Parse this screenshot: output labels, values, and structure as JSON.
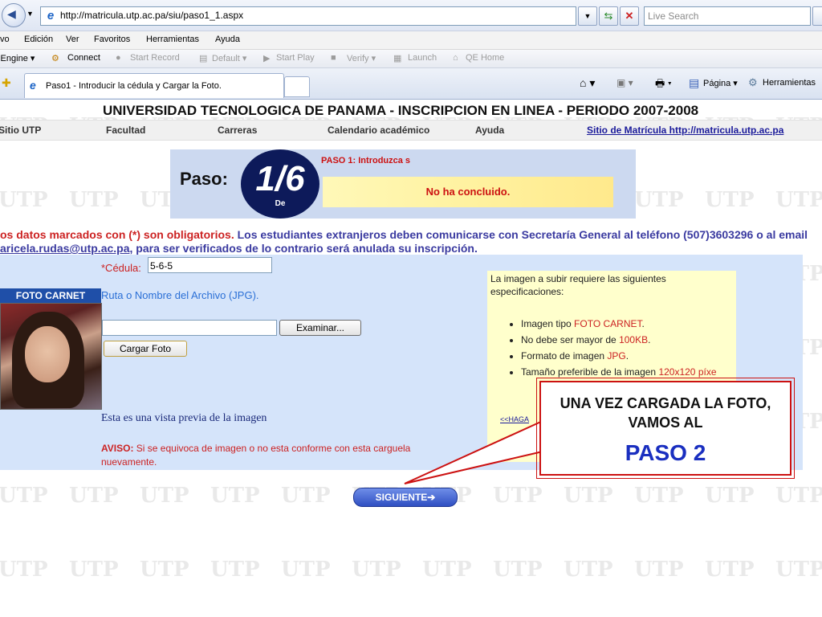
{
  "browser": {
    "url": "http://matricula.utp.ac.pa/siu/paso1_1.aspx",
    "search_placeholder": "Live Search",
    "menu": [
      "vo",
      "Edición",
      "Ver",
      "Favoritos",
      "Herramientas",
      "Ayuda"
    ],
    "toolbar": {
      "engine": "QEngine ▾",
      "connect": "Connect",
      "start_record": "Start Record",
      "default": "Default ▾",
      "start_play": "Start Play",
      "verify": "Verify ▾",
      "launch": "Launch",
      "qe_home": "QE Home"
    },
    "tab_title": "Paso1 - Introducir la cédula y Cargar la Foto.",
    "command_bar": {
      "pagina": "Página ▾",
      "herramientas": "Herramientas"
    }
  },
  "site": {
    "title": "UNIVERSIDAD TECNOLOGICA DE PANAMA - INSCRIPCION EN LINEA - PERIODO 2007-2008",
    "nav": [
      "Sitio UTP",
      "Facultad",
      "Carreras",
      "Calendario académico",
      "Ayuda"
    ],
    "nav_link": "Sitio de Matrícula http://matricula.utp.ac.pa",
    "watermark": "UTP"
  },
  "step": {
    "word": "Paso:",
    "number": "1/6",
    "de": "De",
    "title": "PASO 1: Introduzca s",
    "status": "No ha concluido."
  },
  "notice": {
    "red": "os datos marcados con (*) son obligatorios.",
    "line1_rest": " Los estudiantes extranjeros deben comunicarse con Secretaría General al teléfono (507)3603296 o al email",
    "email": "aricela.rudas@utp.ac.pa",
    "line2_rest": ", para ser verificados de lo contrario será anulada su inscripción."
  },
  "form": {
    "cedula_label": "*Cédula:",
    "cedula_value": "5-6-5",
    "foto_header": "FOTO CARNET",
    "ruta_label": "Ruta o Nombre del Archivo (JPG).",
    "file_value": "",
    "examinar": "Examinar...",
    "cargar": "Cargar Foto",
    "preview_label": "Esta es una vista previa de la imagen",
    "aviso_title": "AVISO:",
    "aviso_text": " Si se equivoca de imagen o no esta conforme con esta carguela nuevamente.",
    "siguiente": "SIGUIENTE➔"
  },
  "spec": {
    "intro": "La imagen a subir requiere las siguientes especificaciones:",
    "items": [
      {
        "pre": "Imagen tipo ",
        "hl": "FOTO CARNET",
        "post": "."
      },
      {
        "pre": "No debe ser mayor de ",
        "hl": "100KB",
        "post": "."
      },
      {
        "pre": "Formato de imagen ",
        "hl": "JPG",
        "post": "."
      },
      {
        "pre": "Tamaño preferible de la imagen ",
        "hl": "120x120 píxe",
        "post": ""
      }
    ],
    "link": "<<HAGA"
  },
  "callout": {
    "text": "UNA VEZ CARGADA LA FOTO, VAMOS AL",
    "big": "PASO 2"
  },
  "colors": {
    "accent_red": "#cc2222",
    "nav_blue": "#1f4fa8",
    "callout_blue": "#1a2fc0"
  }
}
